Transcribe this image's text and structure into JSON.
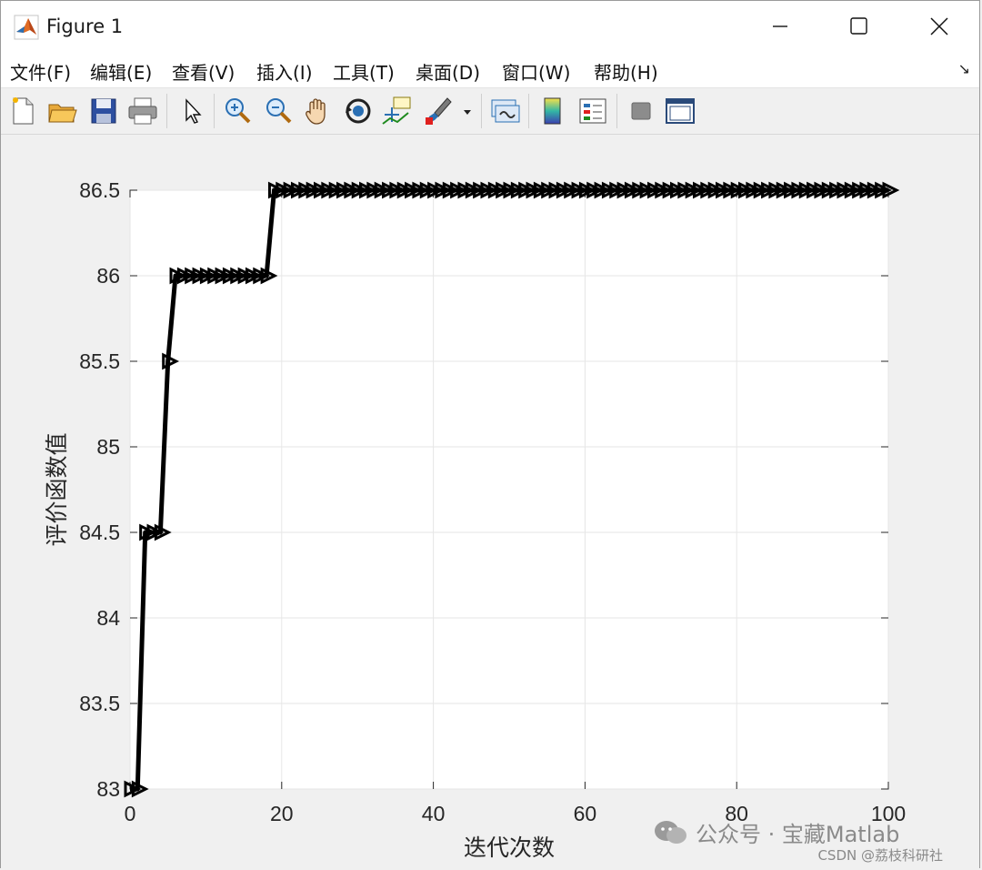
{
  "window": {
    "title": "Figure 1",
    "controls": {
      "minimize": "minimize-icon",
      "maximize": "maximize-icon",
      "close": "close-icon"
    }
  },
  "menu": {
    "items": [
      "文件(F)",
      "编辑(E)",
      "查看(V)",
      "插入(I)",
      "工具(T)",
      "桌面(D)",
      "窗口(W)",
      "帮助(H)"
    ],
    "overflow_arrow": "↘"
  },
  "toolbar": {
    "icons": [
      "new-figure-icon",
      "open-file-icon",
      "save-icon",
      "print-icon",
      "pointer-icon",
      "zoom-in-icon",
      "zoom-out-icon",
      "pan-hand-icon",
      "rotate-3d-icon",
      "data-cursor-icon",
      "brush-icon",
      "brush-dropdown-icon",
      "link-plot-icon",
      "colorbar-icon",
      "legend-icon",
      "hide-plot-tools-icon",
      "show-plot-tools-icon"
    ]
  },
  "colors": {
    "line": "#000000",
    "grid": "#e6e6e6",
    "axes_bg": "#ffffff",
    "figure_bg": "#f0f0f0"
  },
  "chart_data": {
    "type": "line",
    "xlabel": "迭代次数",
    "ylabel": "评价函数值",
    "xlim": [
      0,
      100
    ],
    "ylim": [
      83,
      86.5
    ],
    "xticks": [
      "0",
      "20",
      "40",
      "60",
      "80",
      "100"
    ],
    "yticks": [
      "83",
      "83.5",
      "84",
      "84.5",
      "85",
      "85.5",
      "86",
      "86.5"
    ],
    "grid": true,
    "marker": "triangle-right",
    "x": [
      0,
      1,
      2,
      3,
      4,
      5,
      6,
      7,
      8,
      9,
      10,
      11,
      12,
      13,
      14,
      15,
      16,
      17,
      18,
      19,
      20,
      21,
      22,
      23,
      24,
      25,
      26,
      27,
      28,
      29,
      30,
      31,
      32,
      33,
      34,
      35,
      36,
      37,
      38,
      39,
      40,
      41,
      42,
      43,
      44,
      45,
      46,
      47,
      48,
      49,
      50,
      51,
      52,
      53,
      54,
      55,
      56,
      57,
      58,
      59,
      60,
      61,
      62,
      63,
      64,
      65,
      66,
      67,
      68,
      69,
      70,
      71,
      72,
      73,
      74,
      75,
      76,
      77,
      78,
      79,
      80,
      81,
      82,
      83,
      84,
      85,
      86,
      87,
      88,
      89,
      90,
      91,
      92,
      93,
      94,
      95,
      96,
      97,
      98,
      99,
      100
    ],
    "y": [
      83,
      83,
      84.5,
      84.5,
      84.5,
      85.5,
      86,
      86,
      86,
      86,
      86,
      86,
      86,
      86,
      86,
      86,
      86,
      86,
      86,
      86.5,
      86.5,
      86.5,
      86.5,
      86.5,
      86.5,
      86.5,
      86.5,
      86.5,
      86.5,
      86.5,
      86.5,
      86.5,
      86.5,
      86.5,
      86.5,
      86.5,
      86.5,
      86.5,
      86.5,
      86.5,
      86.5,
      86.5,
      86.5,
      86.5,
      86.5,
      86.5,
      86.5,
      86.5,
      86.5,
      86.5,
      86.5,
      86.5,
      86.5,
      86.5,
      86.5,
      86.5,
      86.5,
      86.5,
      86.5,
      86.5,
      86.5,
      86.5,
      86.5,
      86.5,
      86.5,
      86.5,
      86.5,
      86.5,
      86.5,
      86.5,
      86.5,
      86.5,
      86.5,
      86.5,
      86.5,
      86.5,
      86.5,
      86.5,
      86.5,
      86.5,
      86.5,
      86.5,
      86.5,
      86.5,
      86.5,
      86.5,
      86.5,
      86.5,
      86.5,
      86.5,
      86.5,
      86.5,
      86.5,
      86.5,
      86.5,
      86.5,
      86.5,
      86.5,
      86.5,
      86.5,
      86.5
    ]
  },
  "watermark": {
    "text": "公众号 · 宝藏Matlab",
    "credit": "CSDN @荔枝科研社"
  }
}
